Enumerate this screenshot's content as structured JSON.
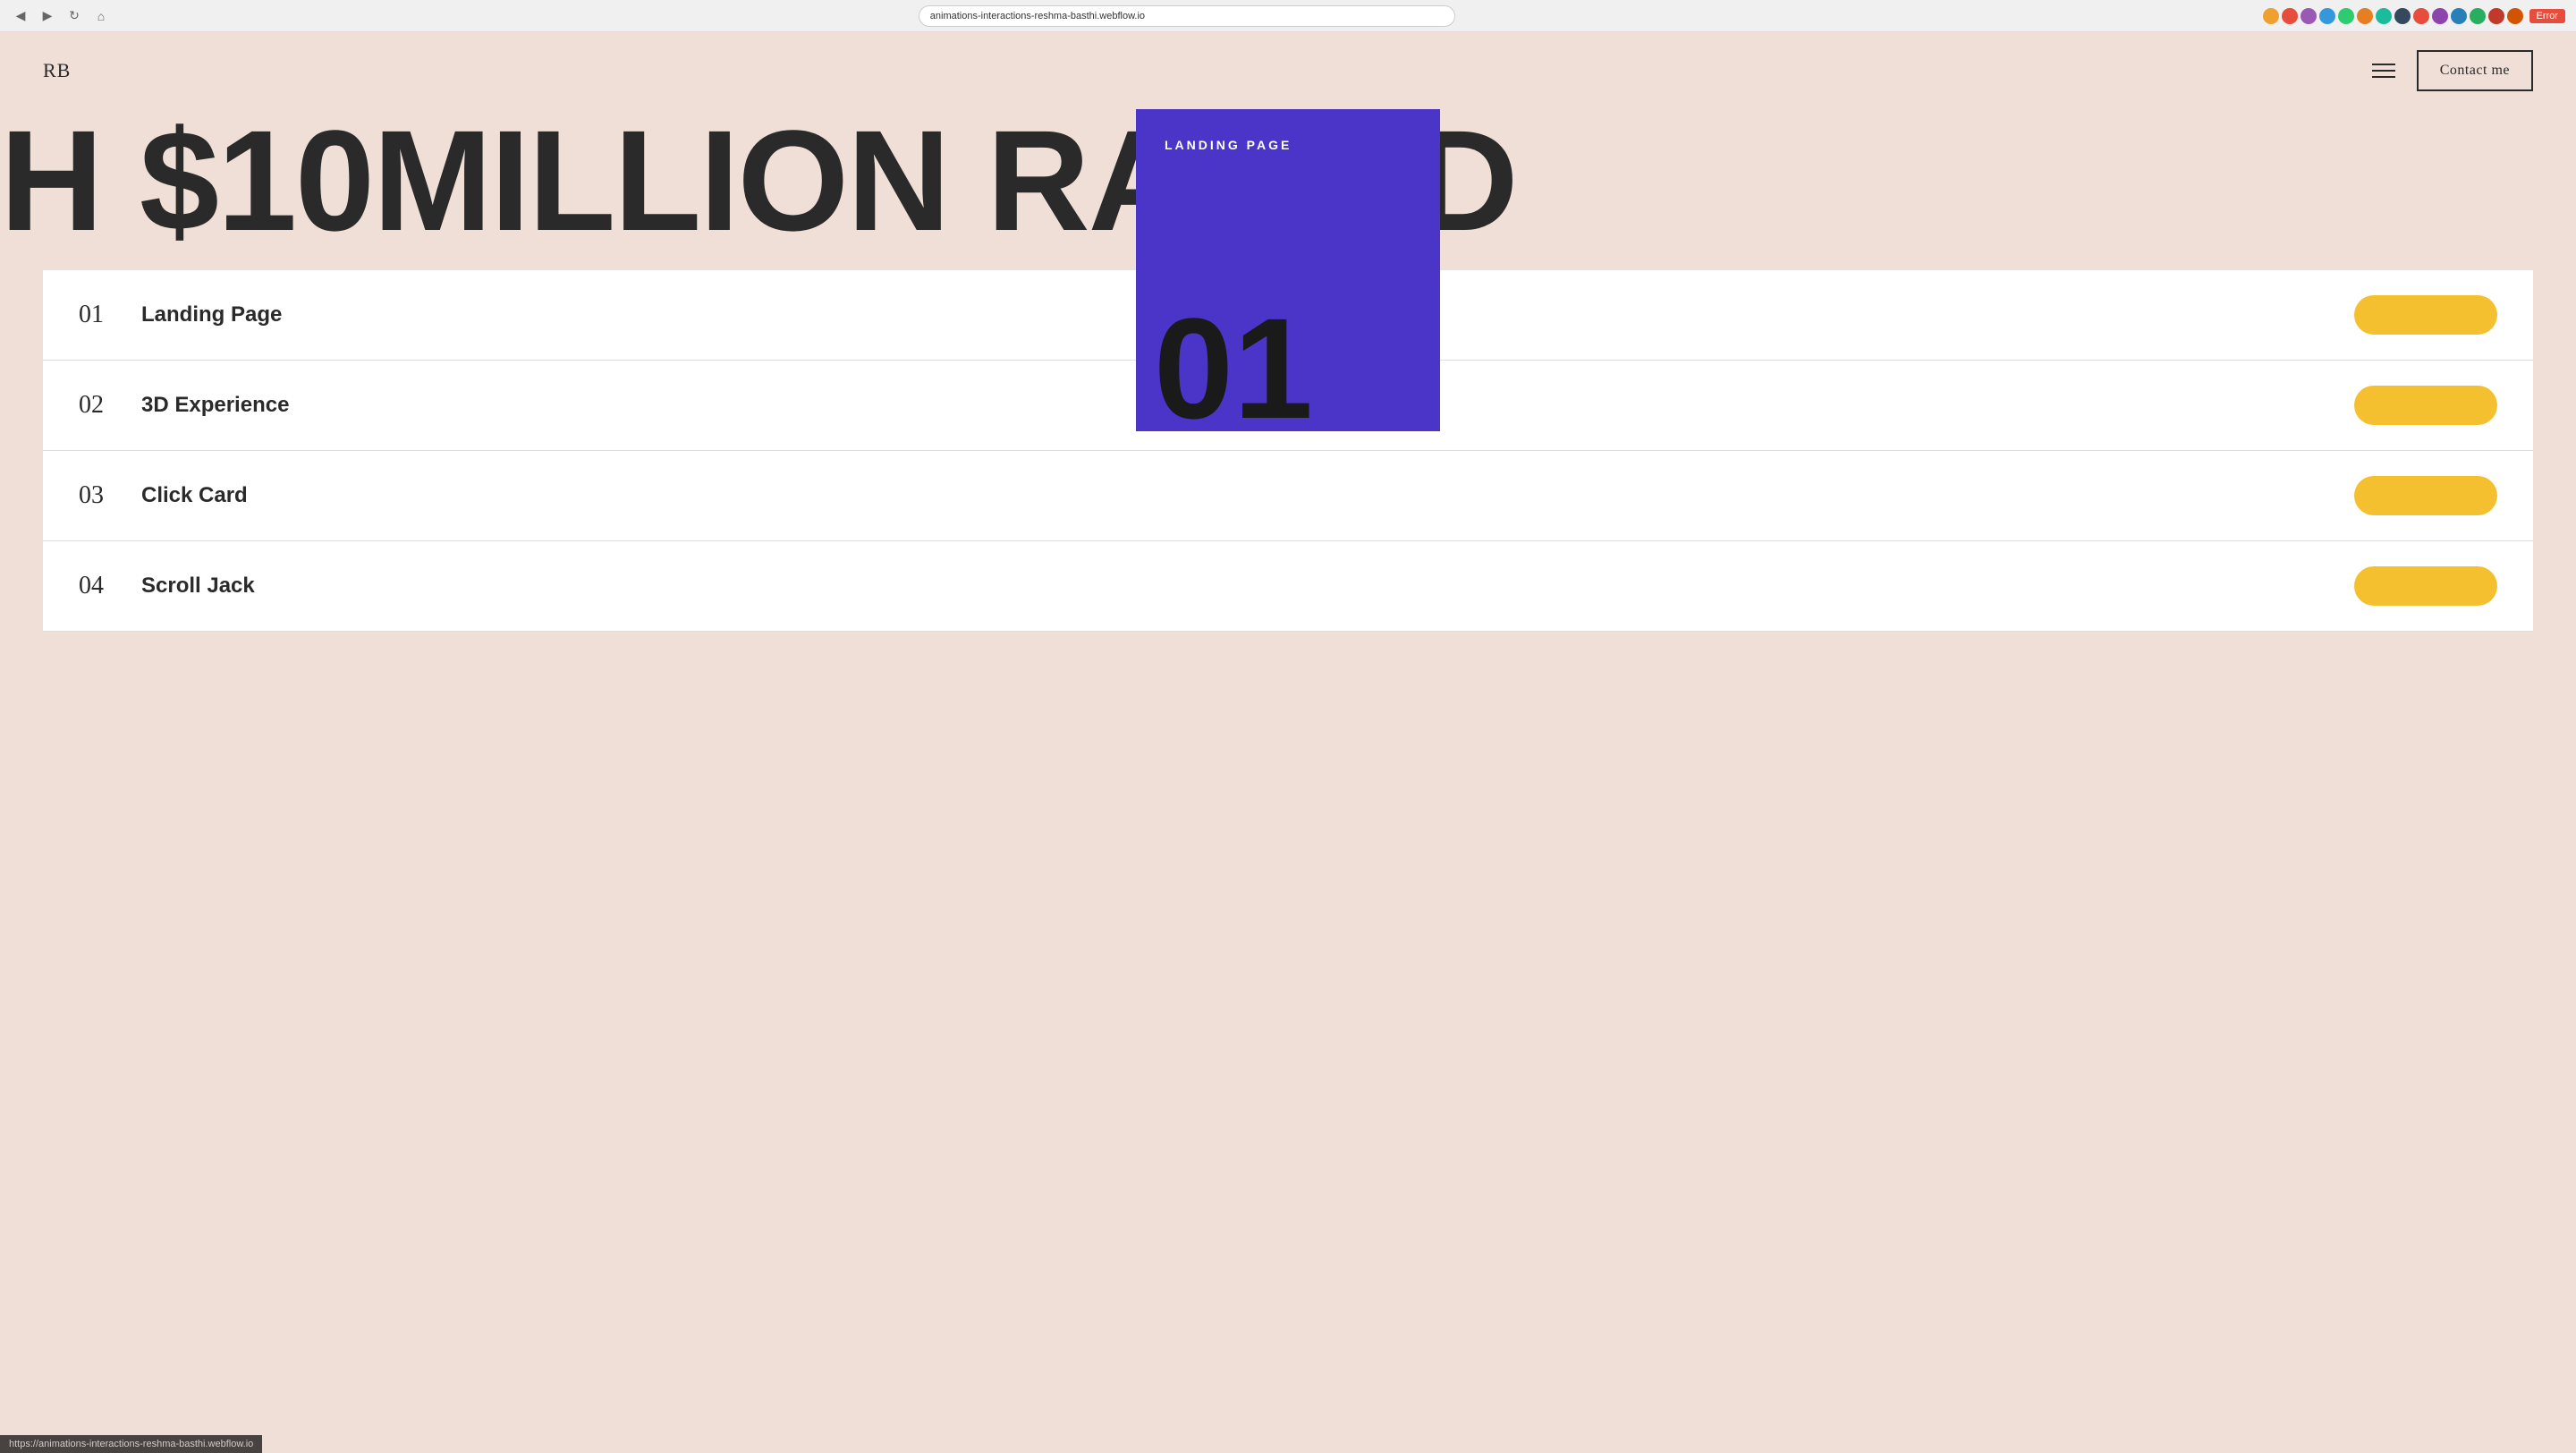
{
  "browser": {
    "url": "animations-interactions-reshma-basthi.webflow.io",
    "back_icon": "◀",
    "forward_icon": "▶",
    "refresh_icon": "↻",
    "error_label": "Error"
  },
  "nav": {
    "logo": "RB",
    "menu_icon": "≡",
    "contact_button": "Contact me"
  },
  "hero": {
    "text": "H $10MILLION RAISED"
  },
  "floating_card": {
    "label": "LANDING PAGE",
    "number": "01"
  },
  "portfolio": {
    "items": [
      {
        "number": "01",
        "title": "Landing Page"
      },
      {
        "number": "02",
        "title": "3D Experience"
      },
      {
        "number": "03",
        "title": "Click Card"
      },
      {
        "number": "04",
        "title": "Scroll Jack"
      }
    ]
  },
  "status_bar": {
    "url": "https://animations-interactions-reshma-basthi.webflow.io"
  }
}
